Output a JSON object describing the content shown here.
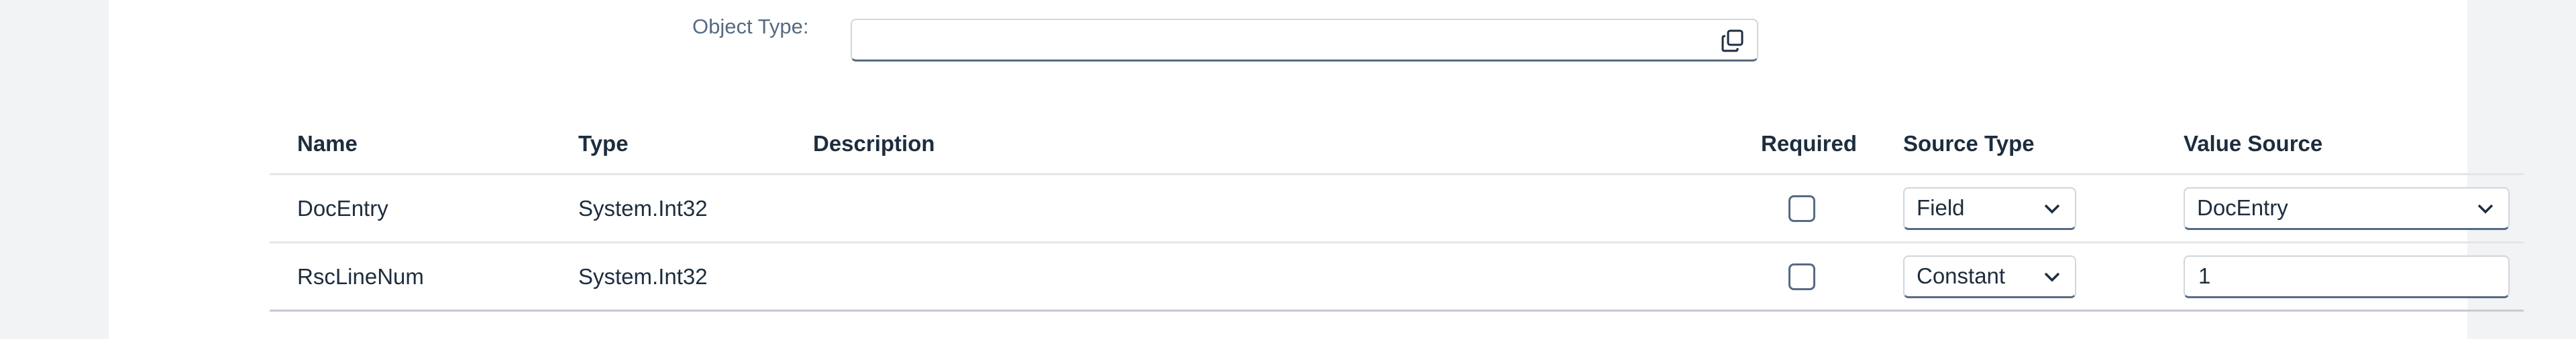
{
  "form": {
    "object_type_label": "Object Type:",
    "object_type_value": ""
  },
  "table": {
    "headers": {
      "name": "Name",
      "type": "Type",
      "description": "Description",
      "required": "Required",
      "source_type": "Source Type",
      "value_source": "Value Source"
    },
    "rows": [
      {
        "name": "DocEntry",
        "type": "System.Int32",
        "description": "",
        "required": false,
        "source_type": "Field",
        "value_source": "DocEntry"
      },
      {
        "name": "RscLineNum",
        "type": "System.Int32",
        "description": "",
        "required": false,
        "source_type": "Constant",
        "value_source": "1"
      }
    ]
  },
  "icons": {
    "value_help": "value-help-icon",
    "dropdown": "chevron-down-icon"
  },
  "colors": {
    "page_background": "#f2f3f5",
    "panel_background": "#ffffff",
    "label_text": "#556b82",
    "text": "#1d2d3e",
    "field_border": "#556b82"
  }
}
